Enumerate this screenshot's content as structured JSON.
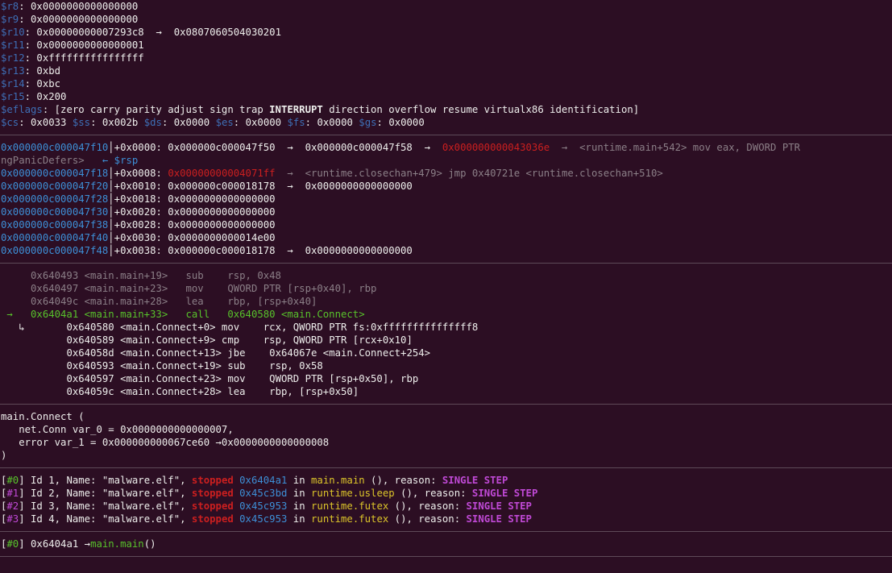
{
  "registers": [
    {
      "name": "$r8",
      "value": ": 0x0000000000000000",
      "deref": ""
    },
    {
      "name": "$r9",
      "value": ": 0x0000000000000000",
      "deref": ""
    },
    {
      "name": "$r10",
      "value": ": 0x00000000007293c8",
      "deref": "  →  0x0807060504030201"
    },
    {
      "name": "$r11",
      "value": ": 0x0000000000000001",
      "deref": ""
    },
    {
      "name": "$r12",
      "value": ": 0xffffffffffffffff",
      "deref": ""
    },
    {
      "name": "$r13",
      "value": ": 0xbd",
      "deref": ""
    },
    {
      "name": "$r14",
      "value": ": 0xbc",
      "deref": ""
    },
    {
      "name": "$r15",
      "value": ": 0x200",
      "deref": ""
    }
  ],
  "eflags": {
    "name": "$eflags",
    "pre": ": [zero carry parity adjust sign trap ",
    "bold": "INTERRUPT",
    "post": " direction overflow resume virtualx86 identification]"
  },
  "segments": [
    {
      "name": "$cs",
      "value": ": 0x0033 "
    },
    {
      "name": "$ss",
      "value": ": 0x002b "
    },
    {
      "name": "$ds",
      "value": ": 0x0000 "
    },
    {
      "name": "$es",
      "value": ": 0x0000 "
    },
    {
      "name": "$fs",
      "value": ": 0x0000 "
    },
    {
      "name": "$gs",
      "value": ": 0x0000"
    }
  ],
  "stack": {
    "row0": {
      "addr": "0x000000c000047f10",
      "bar": "│",
      "off": "+0x0000: 0x000000c000047f50  →  0x000000c000047f58  →  ",
      "red": "0x000000000043036e",
      "rest": "  →  <runtime.main+542> mov eax, DWORD PTR",
      "wrap": "ngPanicDefers>   ",
      "rsp": "← $rsp"
    },
    "row1": {
      "addr": "0x000000c000047f18",
      "bar": "│",
      "off": "+0x0008: ",
      "red": "0x00000000004071ff",
      "rest": "  →  <runtime.closechan+479> jmp 0x40721e <runtime.closechan+510>"
    },
    "rows": [
      {
        "addr": "0x000000c000047f20",
        "bar": "│",
        "text": "+0x0010: 0x000000c000018178  →  0x0000000000000000"
      },
      {
        "addr": "0x000000c000047f28",
        "bar": "│",
        "text": "+0x0018: 0x0000000000000000"
      },
      {
        "addr": "0x000000c000047f30",
        "bar": "│",
        "text": "+0x0020: 0x0000000000000000"
      },
      {
        "addr": "0x000000c000047f38",
        "bar": "│",
        "text": "+0x0028: 0x0000000000000000"
      },
      {
        "addr": "0x000000c000047f40",
        "bar": "│",
        "text": "+0x0030: 0x0000000000014e00"
      },
      {
        "addr": "0x000000c000047f48",
        "bar": "│",
        "text": "+0x0038: 0x000000c000018178  →  0x0000000000000000"
      }
    ]
  },
  "code": {
    "past": [
      "     0x640493 <main.main+19>   sub    rsp, 0x48",
      "     0x640497 <main.main+23>   mov    QWORD PTR [rsp+0x40], rbp",
      "     0x64049c <main.main+28>   lea    rbp, [rsp+0x40]"
    ],
    "current": " →   0x6404a1 <main.main+33>   call   0x640580 <main.Connect>",
    "branch": "   ↳",
    "inner": [
      "       0x640580 <main.Connect+0> mov    rcx, QWORD PTR fs:0xfffffffffffffff8",
      "       0x640589 <main.Connect+9> cmp    rsp, QWORD PTR [rcx+0x10]",
      "       0x64058d <main.Connect+13> jbe    0x64067e <main.Connect+254>",
      "       0x640593 <main.Connect+19> sub    rsp, 0x58",
      "       0x640597 <main.Connect+23> mov    QWORD PTR [rsp+0x50], rbp",
      "       0x64059c <main.Connect+28> lea    rbp, [rsp+0x50]"
    ]
  },
  "args": [
    "main.Connect (",
    "   net.Conn var_0 = 0x0000000000000007,",
    "   error var_1 = 0x000000000067ce60 →0x0000000000000008",
    ")"
  ],
  "threads": [
    {
      "idx": "[#0]",
      "text": " Id 1, Name: \"malware.elf\", ",
      "state": "stopped",
      "addr": " 0x6404a1",
      "in": " in ",
      "func": "main.main",
      "reason_pre": " (), reason: ",
      "reason": "SINGLE STEP"
    },
    {
      "idx": "[#1]",
      "text": " Id 2, Name: \"malware.elf\", ",
      "state": "stopped",
      "addr": " 0x45c3bd",
      "in": " in ",
      "func": "runtime.usleep",
      "reason_pre": " (), reason: ",
      "reason": "SINGLE STEP"
    },
    {
      "idx": "[#2]",
      "text": " Id 3, Name: \"malware.elf\", ",
      "state": "stopped",
      "addr": " 0x45c953",
      "in": " in ",
      "func": "runtime.futex",
      "reason_pre": " (), reason: ",
      "reason": "SINGLE STEP"
    },
    {
      "idx": "[#3]",
      "text": " Id 4, Name: \"malware.elf\", ",
      "state": "stopped",
      "addr": " 0x45c953",
      "in": " in ",
      "func": "runtime.futex",
      "reason_pre": " (), reason: ",
      "reason": "SINGLE STEP"
    }
  ],
  "trace": {
    "idx": "[#0]",
    "addr": " 0x6404a1 →",
    "func": "main.main",
    "tail": "()"
  }
}
